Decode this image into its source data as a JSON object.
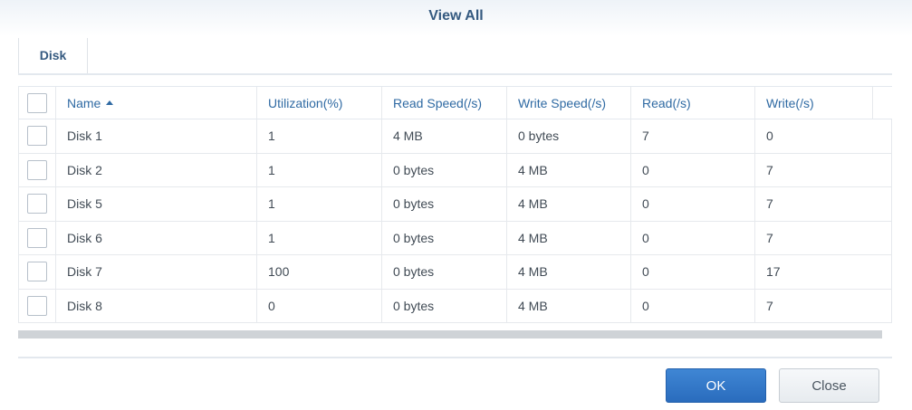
{
  "dialog": {
    "title": "View All"
  },
  "tabs": [
    {
      "label": "Disk",
      "active": true
    }
  ],
  "table": {
    "columns": [
      "Name",
      "Utilization(%)",
      "Read Speed(/s)",
      "Write Speed(/s)",
      "Read(/s)",
      "Write(/s)"
    ],
    "sort": {
      "column": "Name",
      "direction": "ascending"
    },
    "rows": [
      [
        "Disk 1",
        "1",
        "4 MB",
        "0 bytes",
        "7",
        "0"
      ],
      [
        "Disk 2",
        "1",
        "0 bytes",
        "4 MB",
        "0",
        "7"
      ],
      [
        "Disk 5",
        "1",
        "0 bytes",
        "4 MB",
        "0",
        "7"
      ],
      [
        "Disk 6",
        "1",
        "0 bytes",
        "4 MB",
        "0",
        "7"
      ],
      [
        "Disk 7",
        "100",
        "0 bytes",
        "4 MB",
        "0",
        "17"
      ],
      [
        "Disk 8",
        "0",
        "0 bytes",
        "4 MB",
        "0",
        "7"
      ]
    ]
  },
  "buttons": {
    "ok": "OK",
    "close": "Close"
  },
  "colors": {
    "accent": "#2f6aa3",
    "primary_button": "#2a6cbd"
  }
}
